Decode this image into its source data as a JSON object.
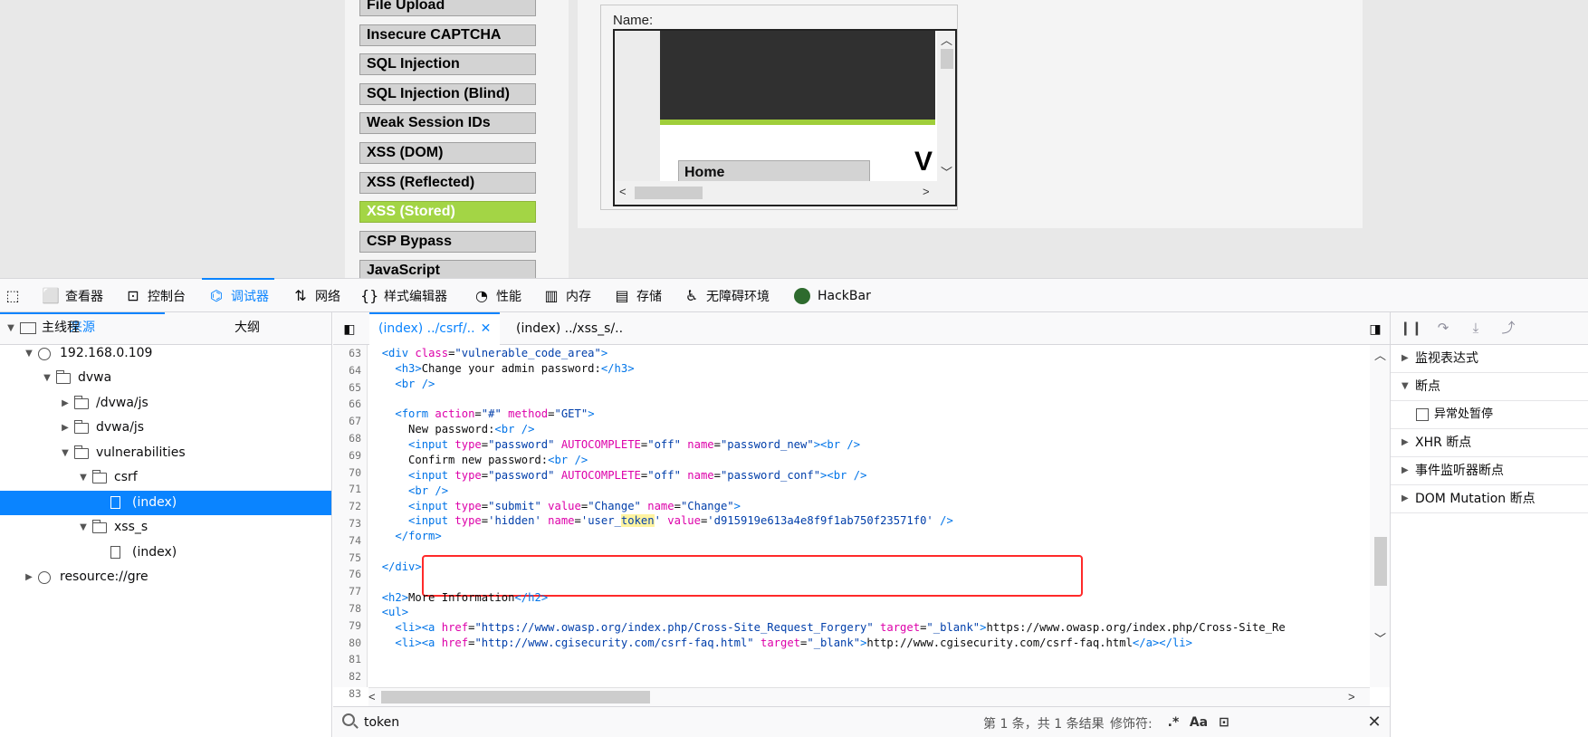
{
  "web": {
    "menu": [
      {
        "label": "File Upload",
        "active": false
      },
      {
        "label": "Insecure CAPTCHA",
        "active": false
      },
      {
        "label": "SQL Injection",
        "active": false
      },
      {
        "label": "SQL Injection (Blind)",
        "active": false
      },
      {
        "label": "Weak Session IDs",
        "active": false
      },
      {
        "label": "XSS (DOM)",
        "active": false
      },
      {
        "label": "XSS (Reflected)",
        "active": false
      },
      {
        "label": "XSS (Stored)",
        "active": true
      },
      {
        "label": "CSP Bypass",
        "active": false
      },
      {
        "label": "JavaScript",
        "active": false
      }
    ],
    "guestbook": {
      "name_label": "Name:",
      "iframe_home": "Home",
      "iframe_v": "V"
    }
  },
  "devtools": {
    "tabs": [
      {
        "label": "查看器",
        "icon": "inspector-icon"
      },
      {
        "label": "控制台",
        "icon": "console-icon"
      },
      {
        "label": "调试器",
        "icon": "debugger-icon",
        "selected": true
      },
      {
        "label": "网络",
        "icon": "network-icon"
      },
      {
        "label": "样式编辑器",
        "icon": "style-editor-icon"
      },
      {
        "label": "性能",
        "icon": "performance-icon"
      },
      {
        "label": "内存",
        "icon": "memory-icon"
      },
      {
        "label": "存储",
        "icon": "storage-icon"
      },
      {
        "label": "无障碍环境",
        "icon": "accessibility-icon"
      },
      {
        "label": "HackBar",
        "icon": "hackbar-icon"
      }
    ],
    "sources": {
      "tabs": [
        "来源",
        "大纲"
      ],
      "tree": [
        {
          "label": "主线程",
          "type": "thread",
          "expanded": true
        },
        {
          "label": "192.168.0.109",
          "type": "globe",
          "expanded": true
        },
        {
          "label": "dvwa",
          "type": "folder",
          "expanded": true
        },
        {
          "label": "/dvwa/js",
          "type": "folder",
          "expanded": false
        },
        {
          "label": "dvwa/js",
          "type": "folder",
          "expanded": false
        },
        {
          "label": "vulnerabilities",
          "type": "folder",
          "expanded": true
        },
        {
          "label": "csrf",
          "type": "folder",
          "expanded": true
        },
        {
          "label": "(index)",
          "type": "file",
          "selected": true
        },
        {
          "label": "xss_s",
          "type": "folder",
          "expanded": true
        },
        {
          "label": "(index)",
          "type": "file"
        },
        {
          "label": "resource://gre",
          "type": "globe",
          "expanded": false
        }
      ]
    },
    "editor": {
      "tabs": [
        {
          "label": "(index) ../csrf/..",
          "selected": true,
          "closable": true
        },
        {
          "label": "(index) ../xss_s/..",
          "selected": false
        }
      ],
      "line_numbers": [
        "63",
        "64",
        "65",
        "66",
        "67",
        "68",
        "69",
        "70",
        "71",
        "72",
        "73",
        "74",
        "75",
        "76",
        "77",
        "78",
        "79",
        "80",
        "81",
        "82",
        "83"
      ],
      "lines": [
        "<div class=\"vulnerable_code_area\">",
        "  <h3>Change your admin password:</h3>",
        "  <br />",
        "",
        "  <form action=\"#\" method=\"GET\">",
        "    New password:<br />",
        "    <input type=\"password\" AUTOCOMPLETE=\"off\" name=\"password_new\"><br />",
        "    Confirm new password:<br />",
        "    <input type=\"password\" AUTOCOMPLETE=\"off\" name=\"password_conf\"><br />",
        "    <br />",
        "    <input type=\"submit\" value=\"Change\" name=\"Change\">",
        "    <input type='hidden' name='user_token' value='d915919e613a4e8f9f1ab750f23571f0' />",
        "  </form>",
        "",
        "</div>",
        "",
        "<h2>More Information</h2>",
        "<ul>",
        "  <li><a href=\"https://www.owasp.org/index.php/Cross-Site_Request_Forgery\" target=\"_blank\">https://www.owasp.org/index.php/Cross-Site_Re",
        "  <li><a href=\"http://www.cgisecurity.com/csrf-faq.html\" target=\"_blank\">http://www.cgisecurity.com/csrf-faq.html</a></li>",
        ""
      ],
      "highlight_term": "token"
    },
    "debugger": {
      "sections": [
        {
          "label": "监视表达式",
          "expanded": false
        },
        {
          "label": "断点",
          "expanded": true
        },
        {
          "label": "异常处暂停",
          "checkbox": true,
          "checked": false
        },
        {
          "label": "XHR 断点",
          "expanded": false
        },
        {
          "label": "事件监听器断点",
          "expanded": false
        },
        {
          "label": "DOM Mutation 断点",
          "expanded": false
        }
      ]
    },
    "search": {
      "value": "token",
      "result_text": "第 1 条，共 1 条结果",
      "modifiers_label": "修饰符:",
      "regex_btn": ".*",
      "case_btn": "Aa",
      "whole_word_btn": "⊡",
      "close_btn": "✕"
    }
  }
}
